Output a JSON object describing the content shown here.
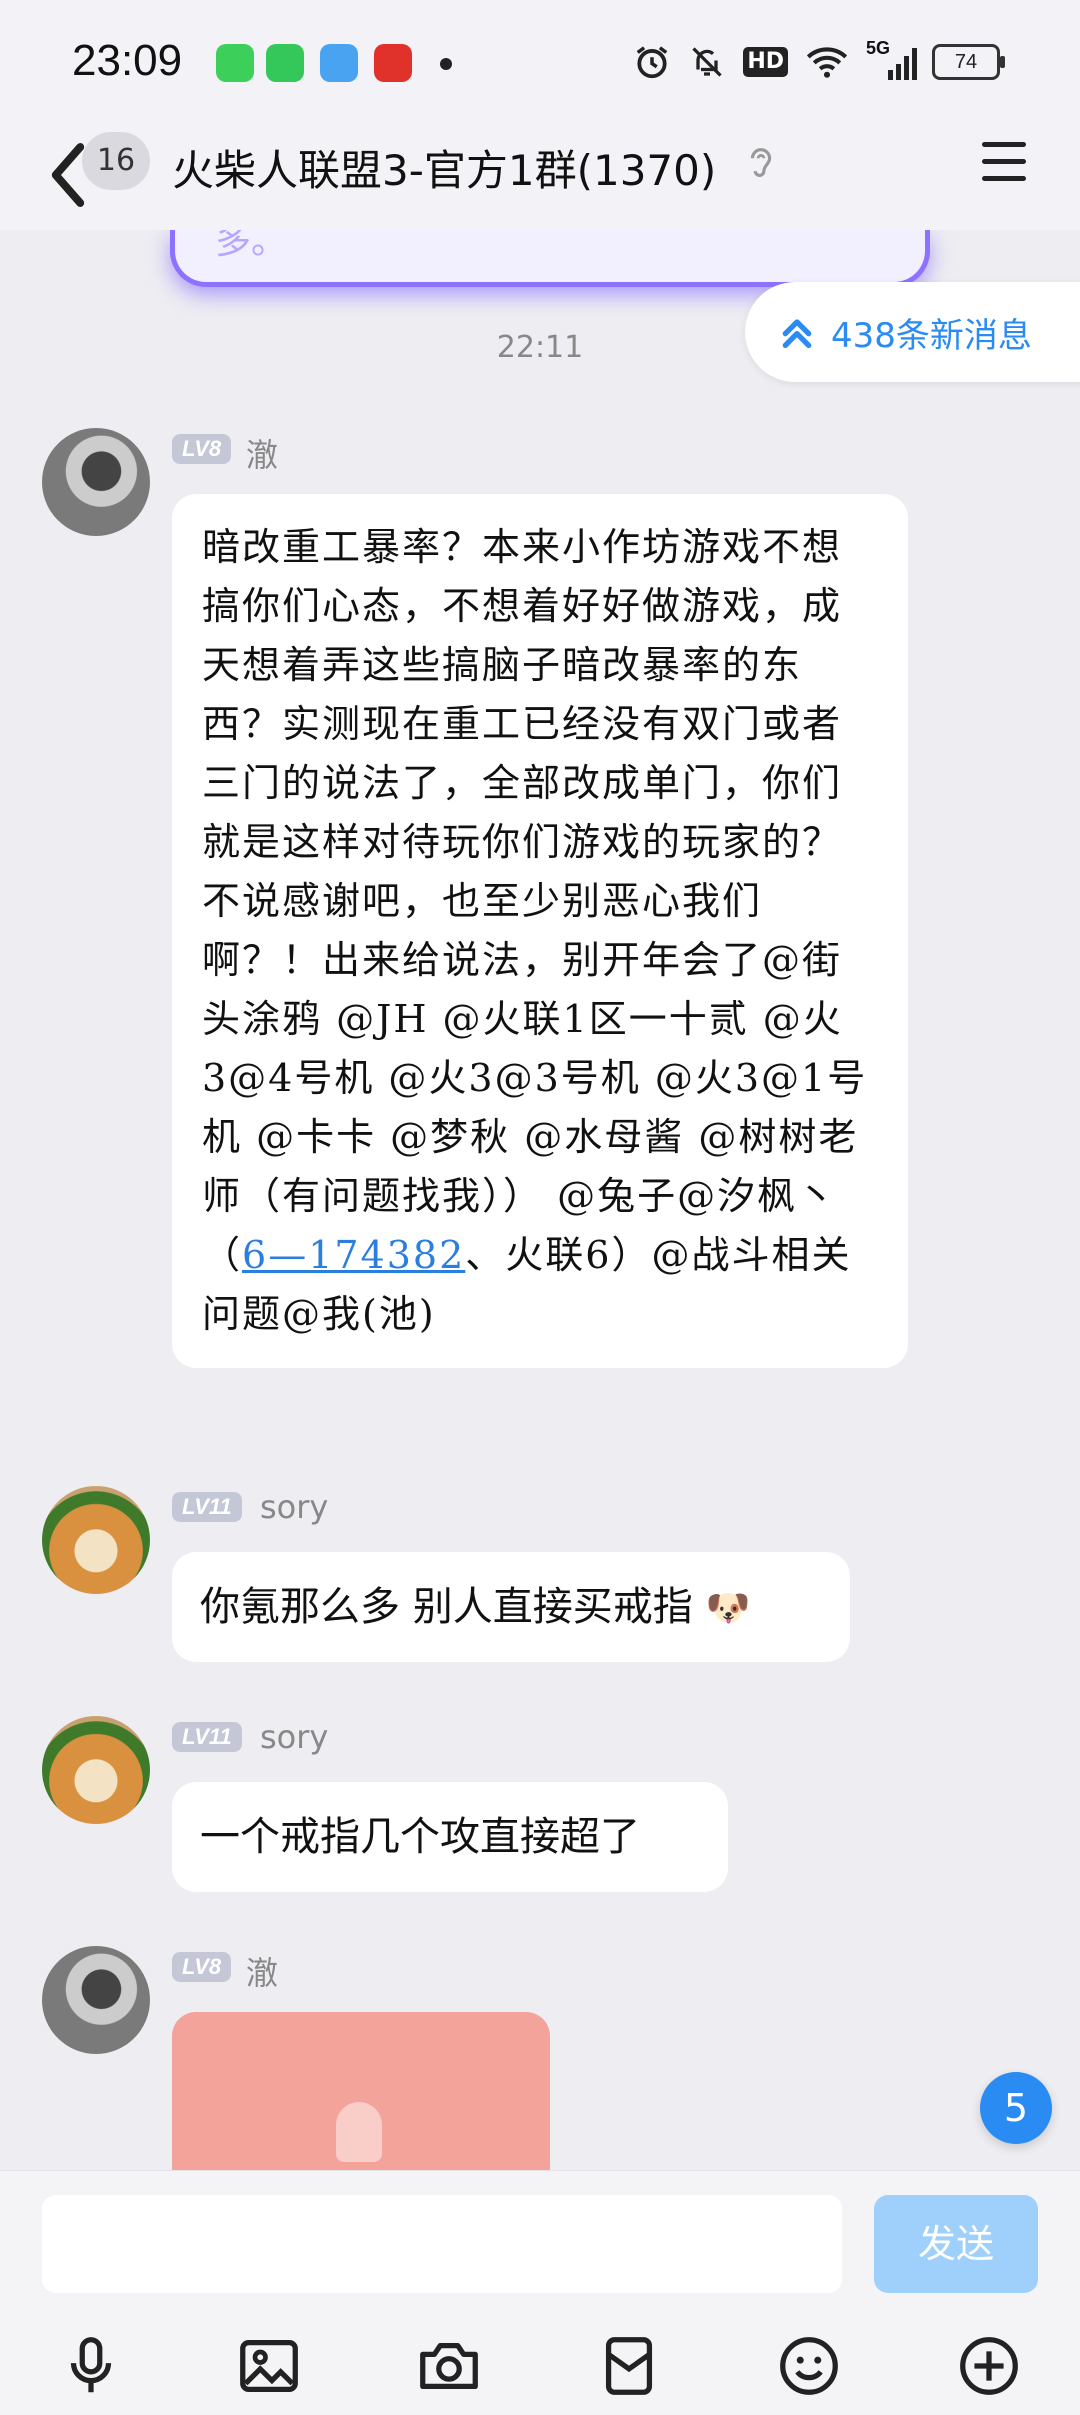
{
  "status_bar": {
    "time": "23:09",
    "battery": "74",
    "network": "5G",
    "hd_label": "HD",
    "icons": [
      "alarm-icon",
      "mute-icon",
      "hd-icon",
      "wifi-icon",
      "signal-icon",
      "battery-icon"
    ]
  },
  "header": {
    "unread_count": "16",
    "title": "火柴人联盟3-官方1群(1370)",
    "icons": [
      "back-icon",
      "ear-icon",
      "menu-icon"
    ]
  },
  "chat": {
    "prev_bubble_text": "多。",
    "new_messages_label": "438条新消息",
    "time_separator": "22:11",
    "messages": [
      {
        "sender": "澈",
        "level": "LV8",
        "text_before_link": "暗改重工暴率？本来小作坊游戏不想搞你们心态，不想着好好做游戏，成天想着弄这些搞脑子暗改暴率的东西？实测现在重工已经没有双门或者三门的说法了，全部改成单门，你们就是这样对待玩你们游戏的玩家的？不说感谢吧，也至少别恶心我们啊？！出来给说法，别开年会了@街头涂鸦 @JH @火联1区一十贰 @火3@4号机 @火3@3号机 @火3@1号机 @卡卡 @梦秋 @水母酱 @树树老师（有问题找我）） @兔子@汐枫丶（",
        "link_text": "6—174382",
        "text_after_link": "、火联6）@战斗相关问题@我(池)"
      },
      {
        "sender": "sory",
        "level": "LV11",
        "text": "你氪那么多 别人直接买戒指",
        "emoji": "🐶"
      },
      {
        "sender": "sory",
        "level": "LV11",
        "text": "一个戒指几个攻直接超了"
      },
      {
        "sender": "澈",
        "level": "LV8"
      }
    ],
    "floating_badge": "5"
  },
  "input": {
    "value": "",
    "send_label": "发送"
  },
  "toolbar": {
    "items": [
      "microphone-icon",
      "image-icon",
      "camera-icon",
      "red-packet-icon",
      "emoji-icon",
      "plus-icon"
    ]
  },
  "colors": {
    "accent": "#2a8bf2",
    "send_disabled": "#9fd0fb",
    "background": "#ededf2"
  }
}
